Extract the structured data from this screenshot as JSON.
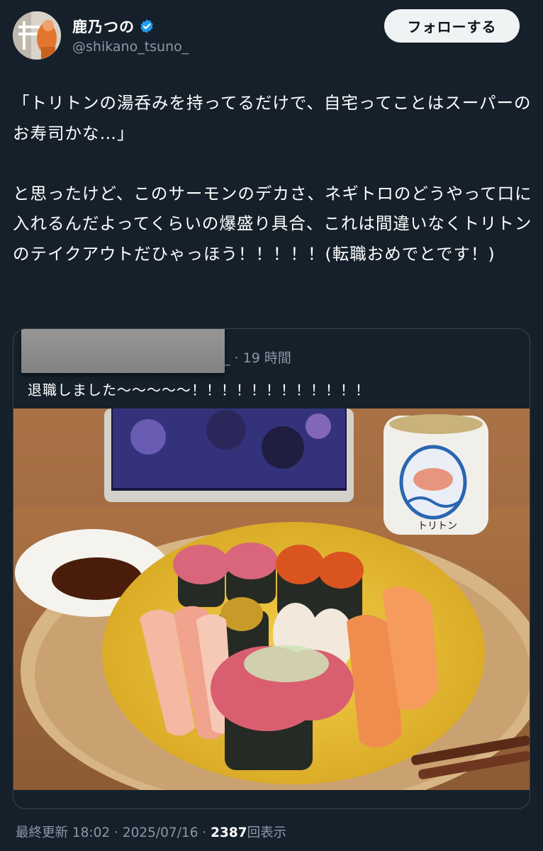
{
  "author": {
    "display_name": "鹿乃つの",
    "handle": "@shikano_tsuno_",
    "verified": true
  },
  "follow_button_label": "フォローする",
  "tweet": {
    "paragraph_1": "「トリトンの湯呑みを持ってるだけで、自宅ってことはスーパーのお寿司かな…」",
    "paragraph_2": "と思ったけど、このサーモンのデカさ、ネギトロのどうやって口に入れるんだよってくらいの爆盛り具合、これは間違いなくトリトンのテイクアウトだひゃっほう！！！！！(転職おめでとです！)"
  },
  "quoted_tweet": {
    "time_ago": "_ · 19 時間",
    "text": "退職しました〜〜〜〜〜！！！！！！！！！！！！",
    "cup_label": "トリトン"
  },
  "footer": {
    "last_updated": "最終更新 18:02 · 2025/07/16 · ",
    "views_count": "2387",
    "views_label": "回表示"
  },
  "colors": {
    "background": "#15202b",
    "secondary_text": "#8b98a5",
    "verified_blue": "#1d9bf0",
    "card_border": "#38444d"
  }
}
